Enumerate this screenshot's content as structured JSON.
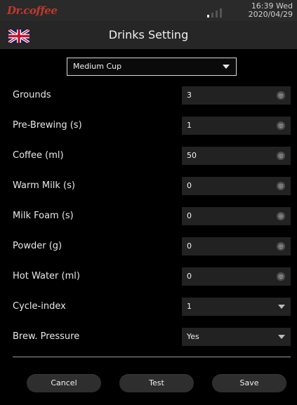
{
  "status_bar": {
    "brand": "Dr.coffee",
    "time": "16:39 Wed",
    "date": "2020/04/29"
  },
  "header": {
    "title": "Drinks Setting",
    "language_icon": "uk-flag-icon"
  },
  "cup_select": {
    "value": "Medium Cup"
  },
  "settings": [
    {
      "label": "Grounds",
      "value": "3",
      "control": "spinner"
    },
    {
      "label": "Pre-Brewing (s)",
      "value": "1",
      "control": "spinner"
    },
    {
      "label": "Coffee (ml)",
      "value": "50",
      "control": "spinner"
    },
    {
      "label": "Warm Milk (s)",
      "value": "0",
      "control": "spinner"
    },
    {
      "label": "Milk Foam (s)",
      "value": "0",
      "control": "spinner"
    },
    {
      "label": "Powder (g)",
      "value": "0",
      "control": "spinner"
    },
    {
      "label": "Hot Water (ml)",
      "value": "0",
      "control": "spinner"
    },
    {
      "label": "Cycle-index",
      "value": "1",
      "control": "dropdown"
    },
    {
      "label": "Brew. Pressure",
      "value": "Yes",
      "control": "dropdown"
    }
  ],
  "buttons": {
    "cancel": "Cancel",
    "test": "Test",
    "save": "Save"
  },
  "colors": {
    "background": "#000000",
    "bar": "#262626",
    "field": "#222222",
    "brand": "#c0392b"
  }
}
